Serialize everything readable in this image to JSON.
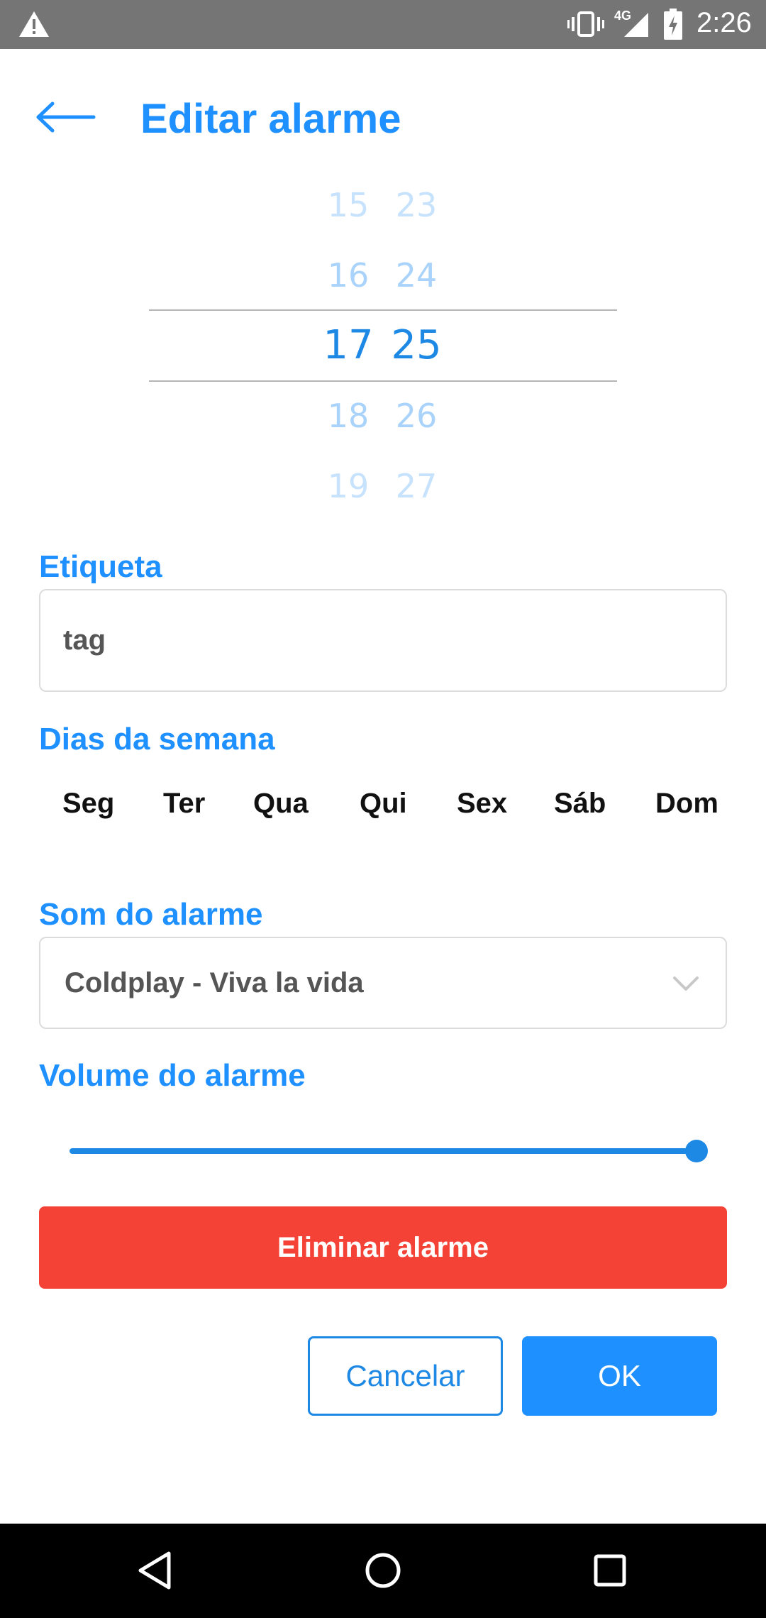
{
  "status_bar": {
    "time": "2:26",
    "network": "4G",
    "icons": [
      "warning-icon",
      "vibrate-icon",
      "signal-icon",
      "battery-charging-icon"
    ]
  },
  "header": {
    "title": "Editar alarme",
    "back_icon": "arrow-left-icon"
  },
  "time_picker": {
    "hours": [
      "15",
      "16",
      "17",
      "18",
      "19"
    ],
    "minutes": [
      "23",
      "24",
      "25",
      "26",
      "27"
    ],
    "selected_hour": "17",
    "selected_minute": "25"
  },
  "label_section": {
    "title": "Etiqueta",
    "value": "tag"
  },
  "days_section": {
    "title": "Dias da semana",
    "days": [
      "Seg",
      "Ter",
      "Qua",
      "Qui",
      "Sex",
      "Sáb",
      "Dom"
    ]
  },
  "sound_section": {
    "title": "Som do alarme",
    "selected": "Coldplay - Viva la vida",
    "icon": "chevron-down-icon"
  },
  "volume_section": {
    "title": "Volume do alarme",
    "value": 1.0
  },
  "actions": {
    "delete_label": "Eliminar alarme",
    "cancel_label": "Cancelar",
    "ok_label": "OK"
  },
  "colors": {
    "accent": "#1e90ff",
    "danger": "#f44336",
    "status_bar": "#757575",
    "nav_bar": "#000000"
  },
  "nav_bar": {
    "icons": [
      "back-triangle-icon",
      "home-circle-icon",
      "recents-square-icon"
    ]
  }
}
